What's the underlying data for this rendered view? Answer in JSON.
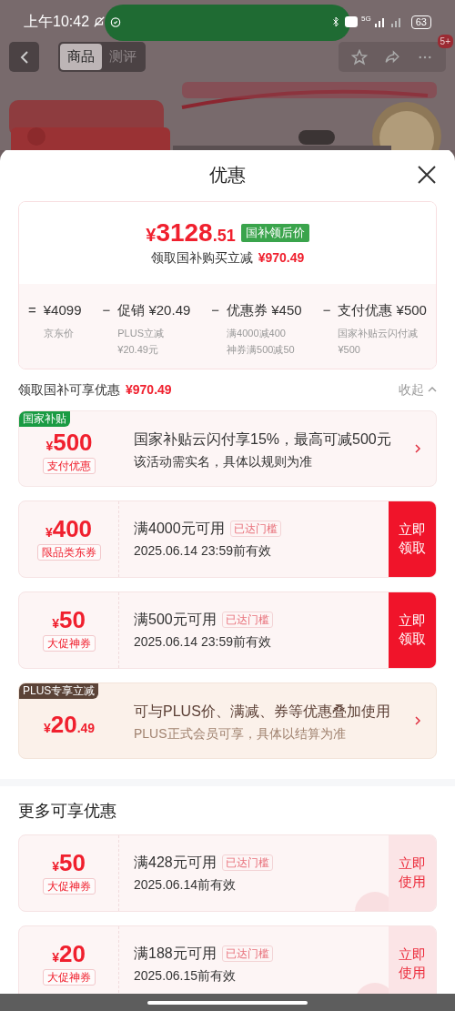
{
  "status_bar": {
    "time": "上午10:42",
    "network": "5G",
    "battery": "63"
  },
  "nav": {
    "tabs": [
      {
        "label": "商品",
        "selected": true
      },
      {
        "label": "测评",
        "selected": false
      }
    ],
    "badge": "5+"
  },
  "sheet": {
    "title": "优惠",
    "summary": {
      "currency": "¥",
      "integer": "3128",
      "decimals": ".51",
      "tag": "国补领后价",
      "caption": "领取国补购买立减",
      "caption_amount": "¥970.49",
      "breakdown": [
        {
          "op": "=",
          "value": "¥4099",
          "notes": [
            "京东价"
          ]
        },
        {
          "op": "−",
          "value": "促销 ¥20.49",
          "notes": [
            "PLUS立减",
            "¥20.49元"
          ]
        },
        {
          "op": "−",
          "value": "优惠券 ¥450",
          "notes": [
            "满4000减400",
            "神券满500减50"
          ]
        },
        {
          "op": "−",
          "value": "支付优惠 ¥500",
          "notes": [
            "国家补贴云闪付减",
            "¥500"
          ]
        }
      ]
    },
    "section": {
      "label": "领取国补可享优惠",
      "amount": "¥970.49",
      "toggle": "收起",
      "expanded": true
    },
    "coupons": [
      {
        "kind": "offer",
        "tag": "国家补贴",
        "color": "#1a9b43",
        "currency": "¥",
        "amount": "500",
        "type_label": "支付优惠",
        "title": "国家补贴云闪付享15%，最高可减500元",
        "detail": "该活动需实名，具体以规则为准"
      },
      {
        "kind": "coupon",
        "currency": "¥",
        "amount": "400",
        "type_label": "限品类东券",
        "title": "满4000元可用",
        "status": "已达门槛",
        "detail": "2025.06.14 23:59前有效",
        "button": {
          "label": "立即领取",
          "kind": "solid"
        }
      },
      {
        "kind": "coupon",
        "currency": "¥",
        "amount": "50",
        "type_label": "大促神券",
        "title": "满500元可用",
        "status": "已达门槛",
        "detail": "2025.06.14 23:59前有效",
        "button": {
          "label": "立即领取",
          "kind": "solid"
        }
      },
      {
        "kind": "plus",
        "tag": "PLUS专享立减",
        "color": "#5b4337",
        "currency": "¥",
        "amount": "20",
        "decimals": ".49",
        "title": "可与PLUS价、满减、券等优惠叠加使用",
        "detail": "PLUS正式会员可享，具体以结算为准"
      }
    ],
    "more": {
      "title": "更多可享优惠",
      "coupons": [
        {
          "kind": "coupon",
          "currency": "¥",
          "amount": "50",
          "type_label": "大促神券",
          "title": "满428元可用",
          "status": "已达门槛",
          "detail": "2025.06.14前有效",
          "button": {
            "label": "立即使用",
            "kind": "light"
          },
          "stamp": true
        },
        {
          "kind": "coupon",
          "currency": "¥",
          "amount": "20",
          "type_label": "大促神券",
          "title": "满188元可用",
          "status": "已达门槛",
          "detail": "2025.06.15前有效",
          "button": {
            "label": "立即使用",
            "kind": "light"
          },
          "stamp": true
        }
      ]
    }
  }
}
